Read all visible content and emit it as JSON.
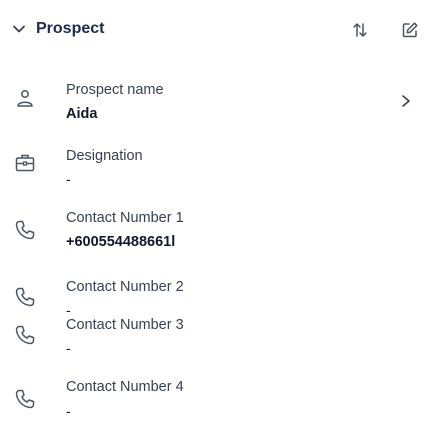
{
  "section": {
    "title": "Prospect",
    "icons": {
      "collapse": "chevron-down-icon",
      "sort": "sort-icon",
      "edit": "edit-icon"
    }
  },
  "fields": [
    {
      "label": "Prospect name",
      "value": "Aida",
      "icon": "person-icon"
    },
    {
      "label": "Designation",
      "value": "-",
      "icon": "briefcase-icon"
    },
    {
      "label": "Contact Number 1",
      "value": "+600554488661l",
      "icon": "phone-icon"
    },
    {
      "label": "Contact Number 2",
      "value": "-",
      "icon": "phone-icon"
    },
    {
      "label": "Contact Number 3",
      "value": "-",
      "icon": "phone-icon"
    },
    {
      "label": "Contact Number 4",
      "value": "-",
      "icon": "phone-icon"
    }
  ],
  "colors": {
    "title": "#1f2a4d",
    "icon": "#4b5563"
  }
}
